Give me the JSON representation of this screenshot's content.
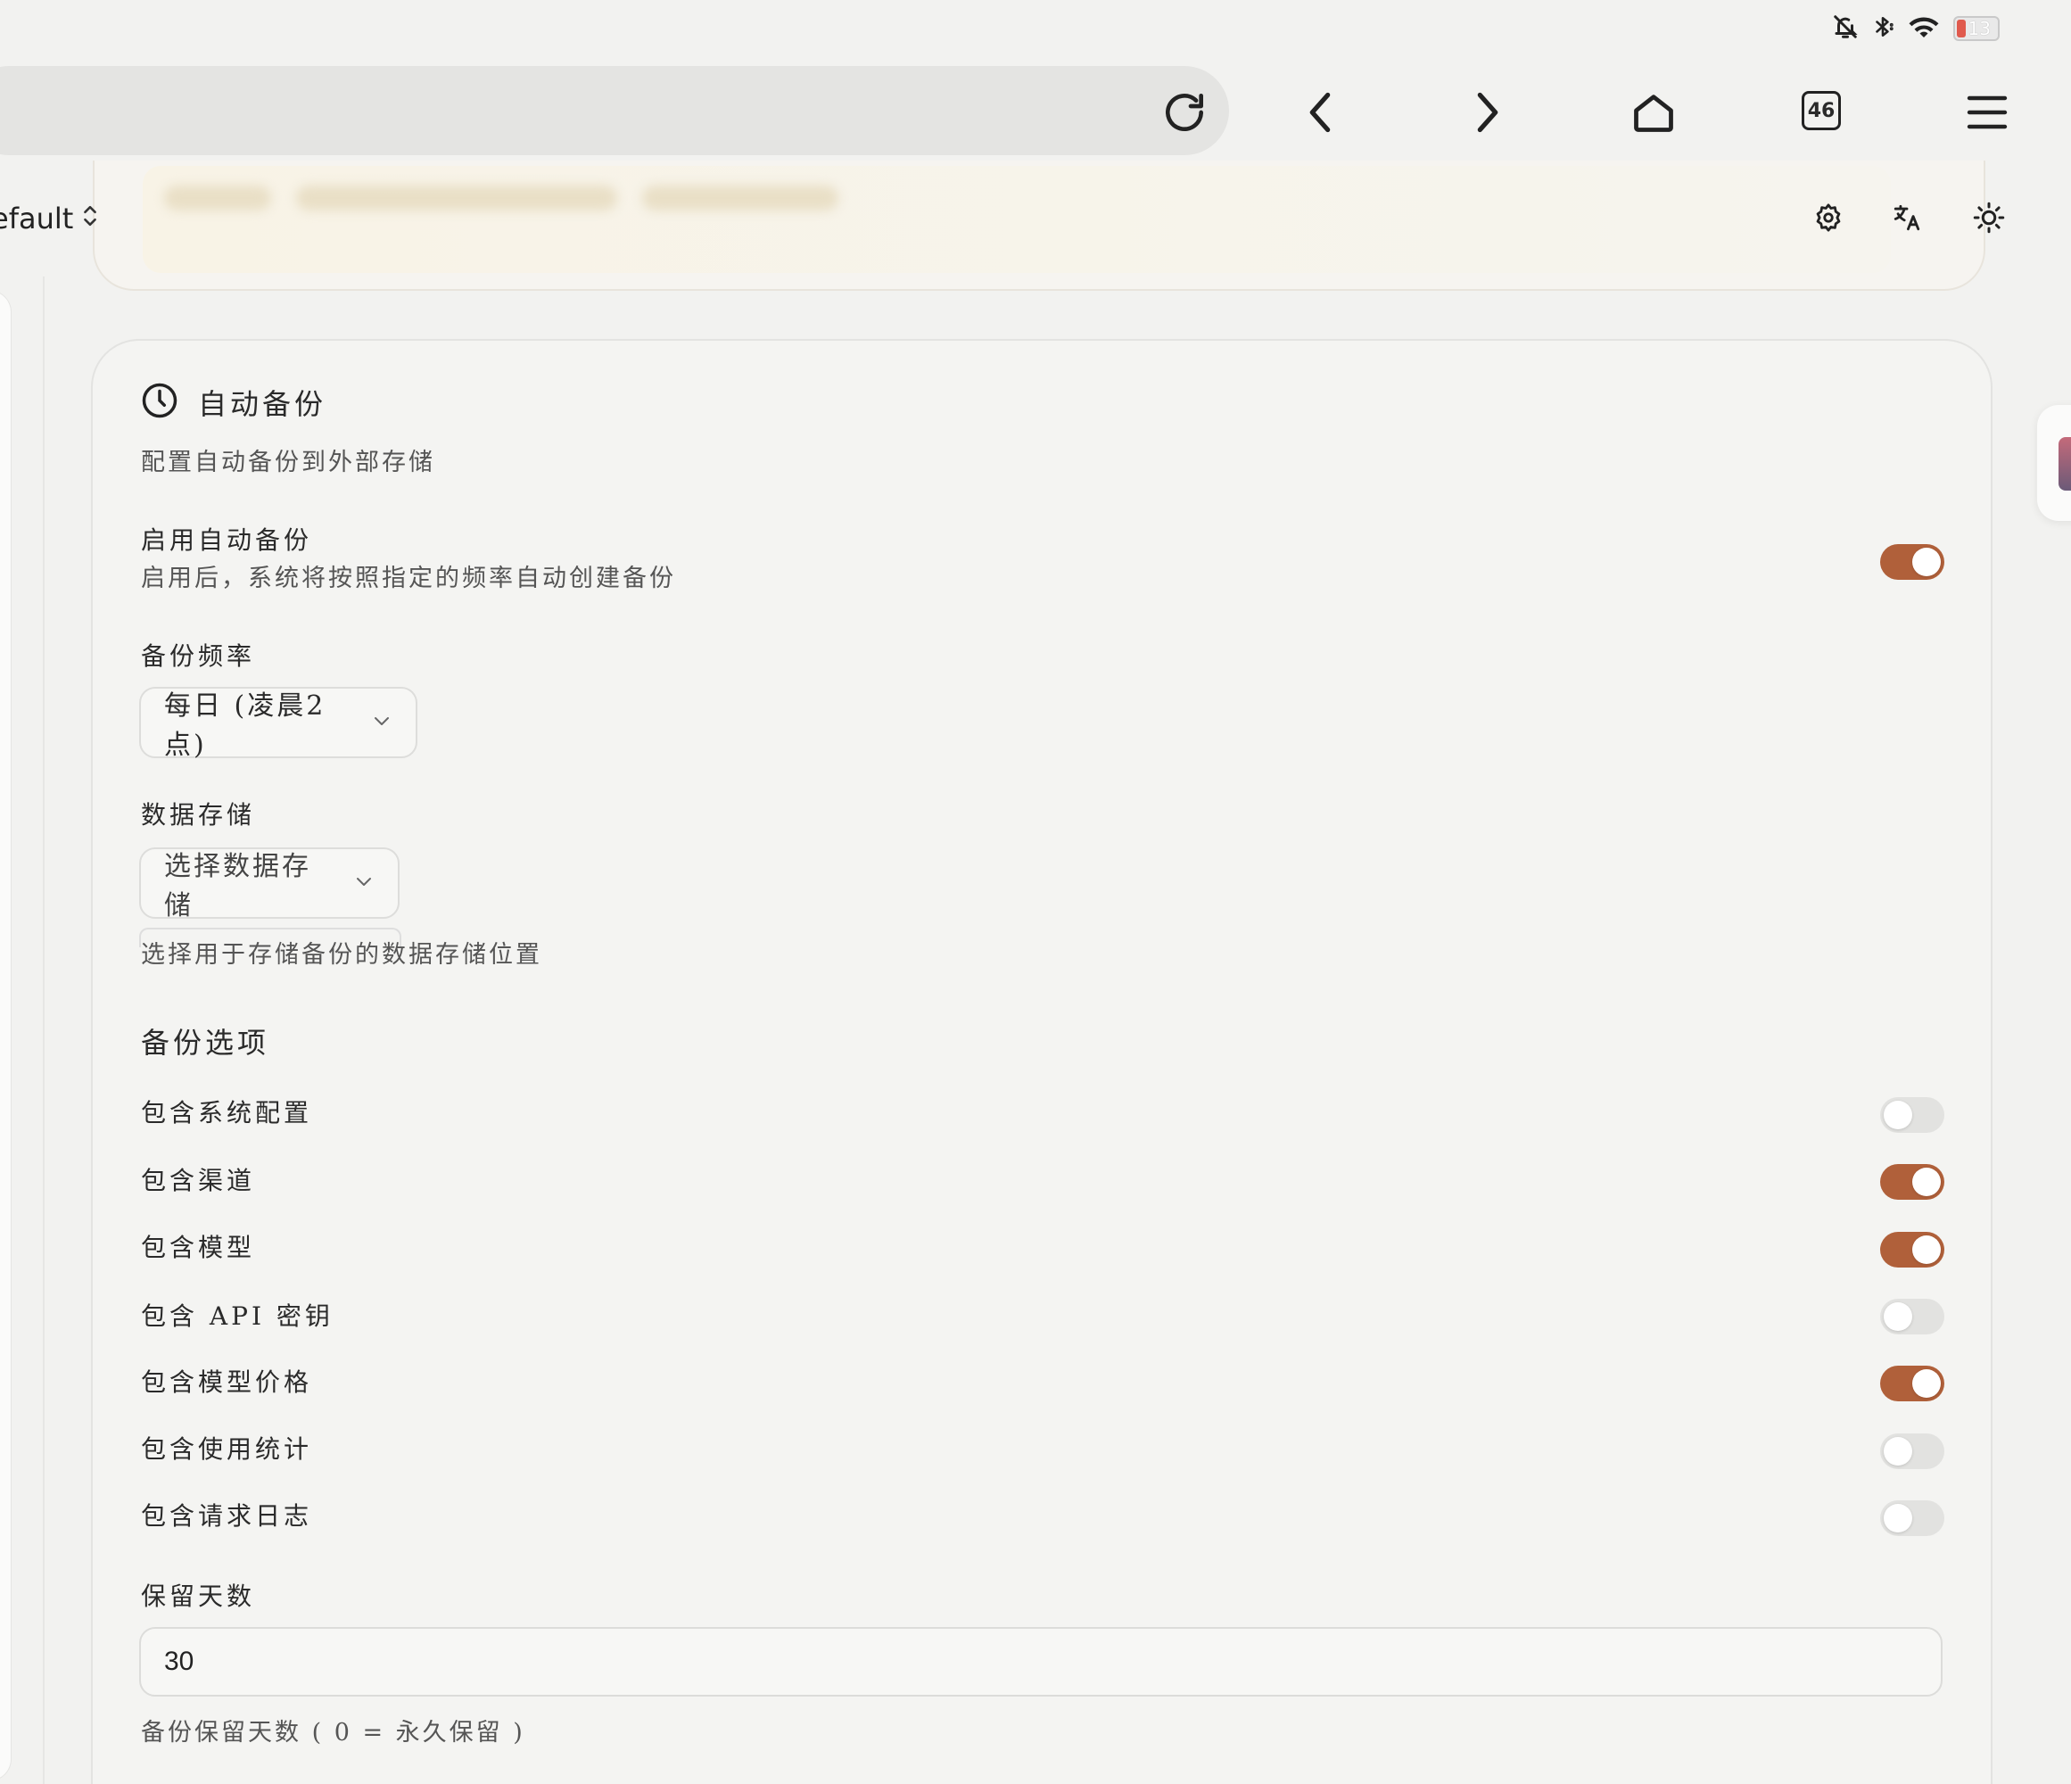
{
  "status_bar": {
    "battery_level": "13",
    "icons": [
      "bell-off-icon",
      "bluetooth-icon",
      "wifi-icon",
      "battery-icon"
    ]
  },
  "browser": {
    "tab_count": "46",
    "icons": [
      "reload-icon",
      "back-icon",
      "forward-icon",
      "home-icon",
      "tabs-icon",
      "menu-icon"
    ]
  },
  "header": {
    "theme_select": "efault",
    "icons": [
      "settings-icon",
      "translate-icon",
      "sun-icon"
    ]
  },
  "backup_card": {
    "title": "自动备份",
    "description": "配置自动备份到外部存储",
    "enable": {
      "label": "启用自动备份",
      "description": "启用后，系统将按照指定的频率自动创建备份",
      "on": true
    },
    "frequency": {
      "label": "备份频率",
      "value": "每日 (凌晨2点)"
    },
    "storage": {
      "label": "数据存储",
      "placeholder": "选择数据存储",
      "hint": "选择用于存储备份的数据存储位置"
    },
    "options_heading": "备份选项",
    "options": [
      {
        "label": "包含系统配置",
        "on": false
      },
      {
        "label": "包含渠道",
        "on": true
      },
      {
        "label": "包含模型",
        "on": true
      },
      {
        "label": "包含 API 密钥",
        "on": false
      },
      {
        "label": "包含模型价格",
        "on": true
      },
      {
        "label": "包含使用统计",
        "on": false
      },
      {
        "label": "包含请求日志",
        "on": false
      }
    ],
    "retention": {
      "label": "保留天数",
      "value": "30",
      "hint": "备份保留天数 ( 0 = 永久保留 )"
    }
  },
  "colors": {
    "accent": "#b0603a",
    "toggle_off": "#e2e2e0",
    "background": "#f2f2f0"
  }
}
